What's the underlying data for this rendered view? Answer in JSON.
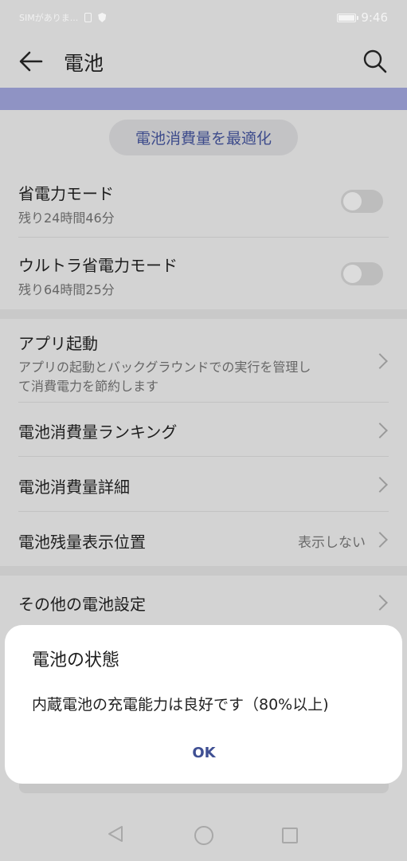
{
  "status_bar": {
    "carrier": "SIMがありま...",
    "time": "9:46"
  },
  "header": {
    "title": "電池"
  },
  "optimize_label": "電池消費量を最適化",
  "power_modes": [
    {
      "label": "省電力モード",
      "sub": "残り24時間46分",
      "enabled": false
    },
    {
      "label": "ウルトラ省電力モード",
      "sub": "残り64時間25分",
      "enabled": false
    }
  ],
  "menu": {
    "app_launch": {
      "label": "アプリ起動",
      "sub_line1": "アプリの起動とバックグラウンドでの実行を管理し",
      "sub_line2": "て消費電力を節約します"
    },
    "ranking": {
      "label": "電池消費量ランキング"
    },
    "details": {
      "label": "電池消費量詳細"
    },
    "indicator": {
      "label": "電池残量表示位置",
      "value": "表示しない"
    },
    "other": {
      "label": "その他の電池設定"
    }
  },
  "dialog": {
    "title": "電池の状態",
    "message": "内蔵電池の充電能力は良好です（80%以上)",
    "ok_label": "OK"
  },
  "icons": {
    "back": "arrow-left",
    "search": "magnifier",
    "nav_back": "triangle-left",
    "nav_home": "circle",
    "nav_recent": "square"
  },
  "colors": {
    "accent": "#3e4c8c",
    "band": "#8f93c4",
    "dim_background": "#d3d3d3"
  }
}
